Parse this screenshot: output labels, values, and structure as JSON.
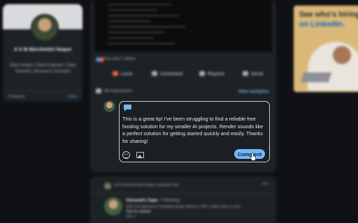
{
  "profile": {
    "name": "A S M Morshedul Hoque",
    "headline": "Data Analyst | Data Engineer | Data Scientist | Research Assistant",
    "footer_left": "Followers",
    "footer_right": "Likes"
  },
  "post": {
    "reactions_text": "You and 2 others",
    "actions": [
      "Love",
      "Comment",
      "Repost",
      "Send"
    ],
    "impressions": "68 impressions",
    "analytics_label": "View analytics"
  },
  "composer": {
    "text": "This is a great tip! I've been struggling to find a reliable free hosting solution for my smaller AI projects. Render sounds like a perfect solution for getting started quickly and easily. Thanks for sharing!",
    "submit_label": "Comment"
  },
  "next_post": {
    "repost_line_name": "A S M Morshedul Hoque",
    "repost_line_suffix": "reposted this",
    "author_name": "Alexandre Zajac",
    "author_badge": "• Following",
    "author_headline": "SDE & AI @Amazon | Building Hungry Minds to 78k+ | Daily Posts on Sof...",
    "author_link": "Visit my website",
    "author_time": "1mo •"
  },
  "ad": {
    "title_line1": "See who's hiring",
    "title_line2": "on LinkedIn."
  },
  "colors": {
    "background": "#101114",
    "card": "#1d2226",
    "accent": "#71b7fb",
    "love": "#e16745"
  },
  "icons": [
    "chat-bubble-icon",
    "emoji-icon",
    "image-icon",
    "love-icon",
    "comment-icon",
    "repost-icon",
    "send-icon",
    "bar-chart-icon",
    "hand-cursor-icon"
  ]
}
